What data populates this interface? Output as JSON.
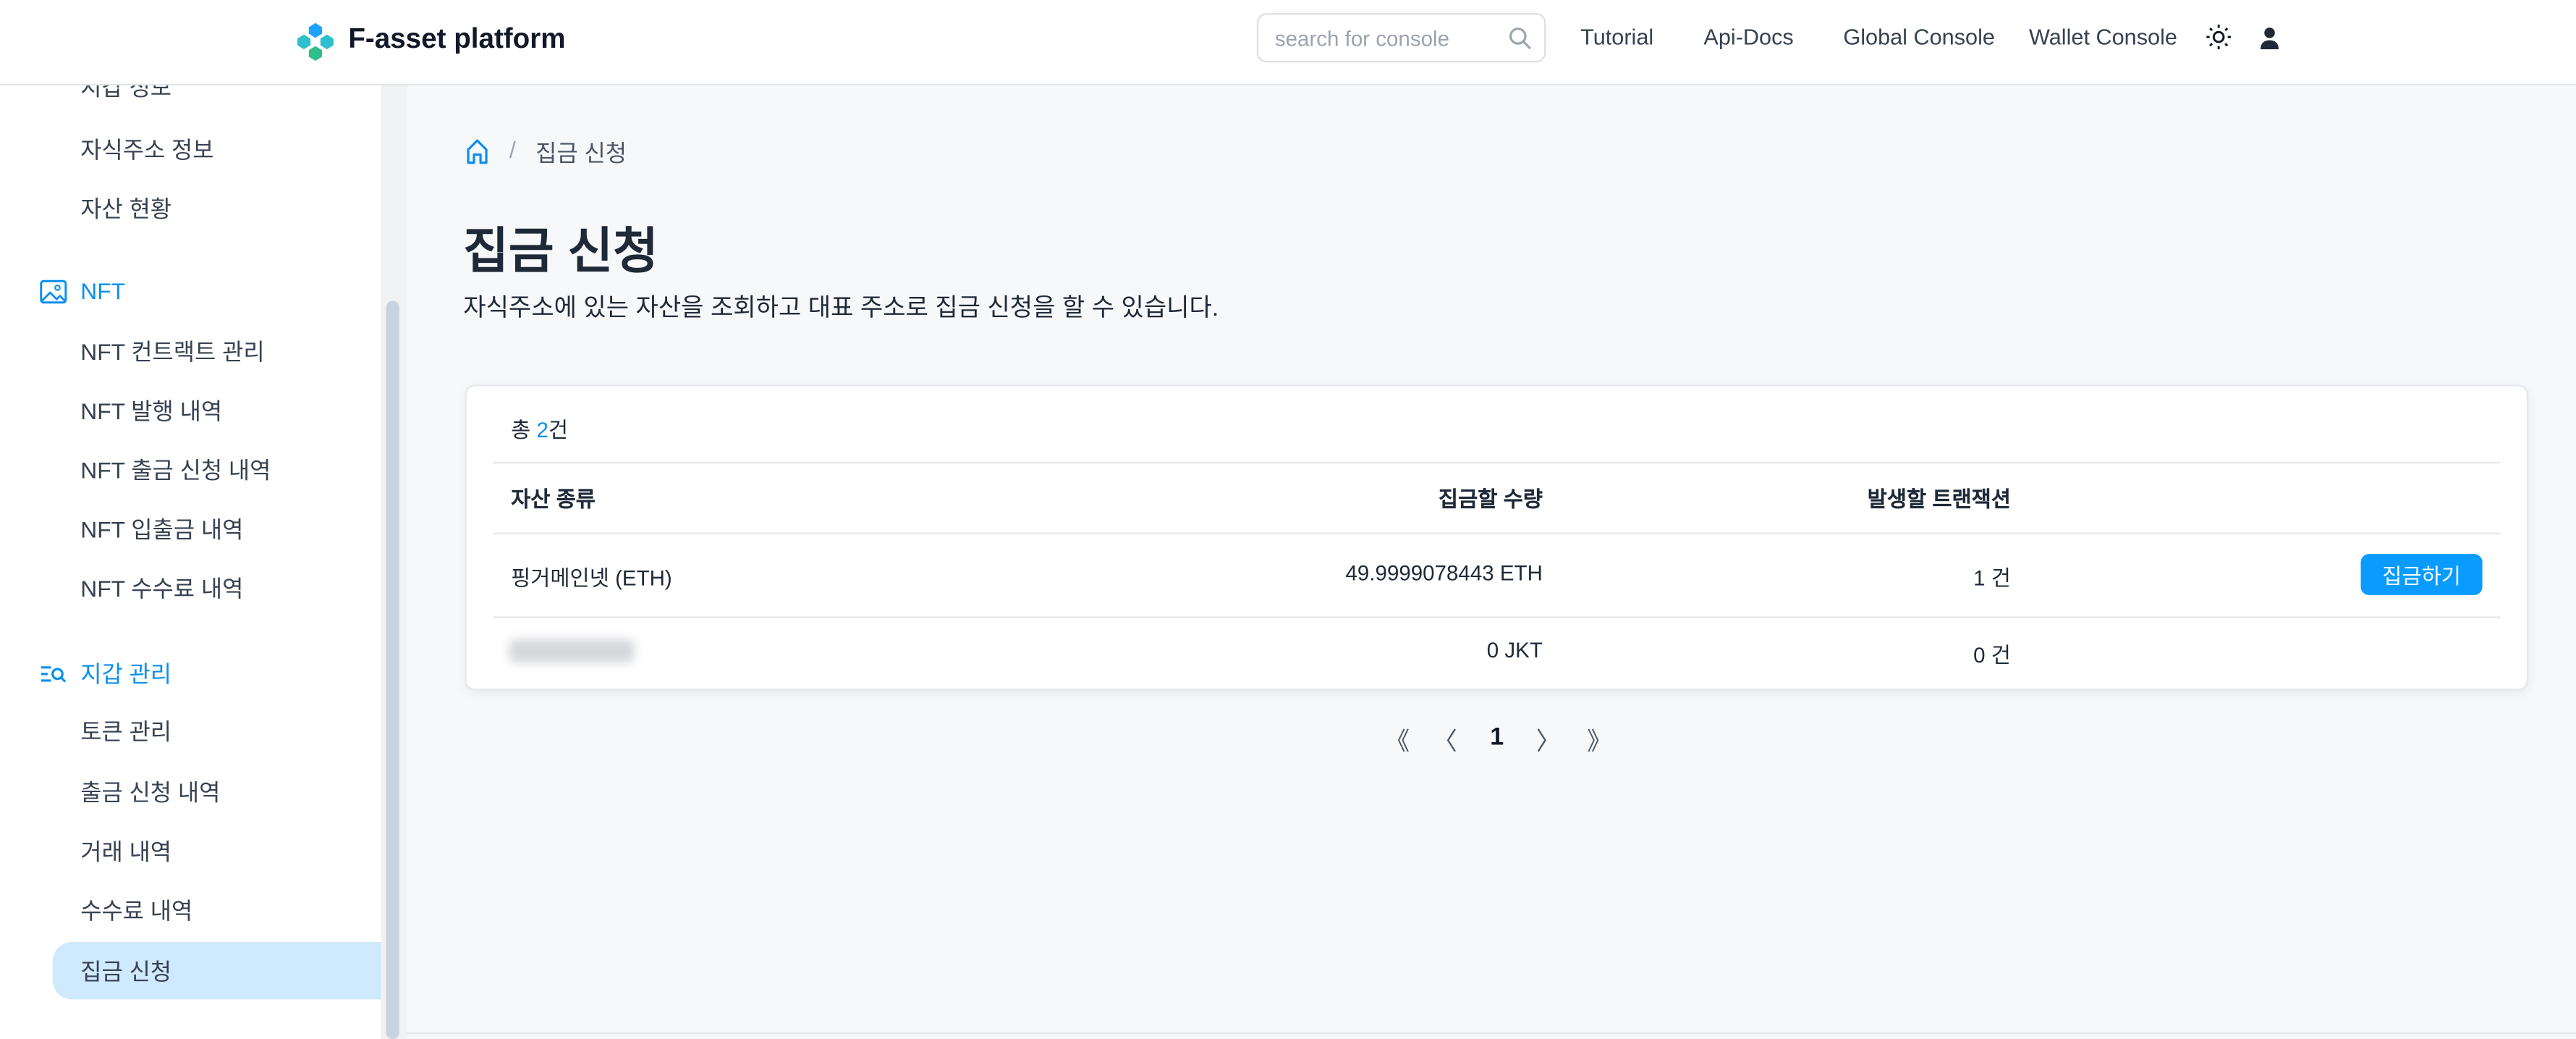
{
  "header": {
    "brand": "F-asset platform",
    "search_placeholder": "search for console",
    "nav": [
      "Tutorial",
      "Api-Docs",
      "Global Console",
      "Wallet Console"
    ],
    "icons": {
      "theme": "sun-icon",
      "user": "user-icon",
      "search": "search-icon"
    }
  },
  "sidebar": {
    "top_items": [
      "지갑 정보",
      "자식주소 정보",
      "자산 현황"
    ],
    "nft": {
      "label": "NFT",
      "items": [
        "NFT 컨트랙트 관리",
        "NFT 발행 내역",
        "NFT 출금 신청 내역",
        "NFT 입출금 내역",
        "NFT 수수료 내역"
      ]
    },
    "wallet": {
      "label": "지갑 관리",
      "items": [
        "토큰 관리",
        "출금 신청 내역",
        "거래 내역",
        "수수료 내역",
        "집금 신청"
      ]
    },
    "active": "집금 신청"
  },
  "breadcrumb": {
    "current": "집금 신청"
  },
  "page": {
    "title": "집금 신청",
    "description": "자식주소에 있는 자산을 조회하고 대표 주소로 집금 신청을 할 수 있습니다."
  },
  "table": {
    "total_prefix": "총 ",
    "total_count": "2",
    "total_suffix": "건",
    "columns": [
      "자산 종류",
      "집금할 수량",
      "발생할 트랜잭션"
    ],
    "rows": [
      {
        "asset": "핑거메인넷 (ETH)",
        "amount": "49.9999078443 ETH",
        "tx": "1 건",
        "action": "집금하기"
      },
      {
        "asset": "",
        "amount": "0 JKT",
        "tx": "0 건"
      }
    ]
  },
  "pagination": {
    "first": "《",
    "prev": "〈",
    "page": "1",
    "next": "〉",
    "last": "》"
  },
  "colors": {
    "accent": "#0a9bff",
    "active_bg": "#cfe9ff",
    "link": "#0a8fef"
  }
}
